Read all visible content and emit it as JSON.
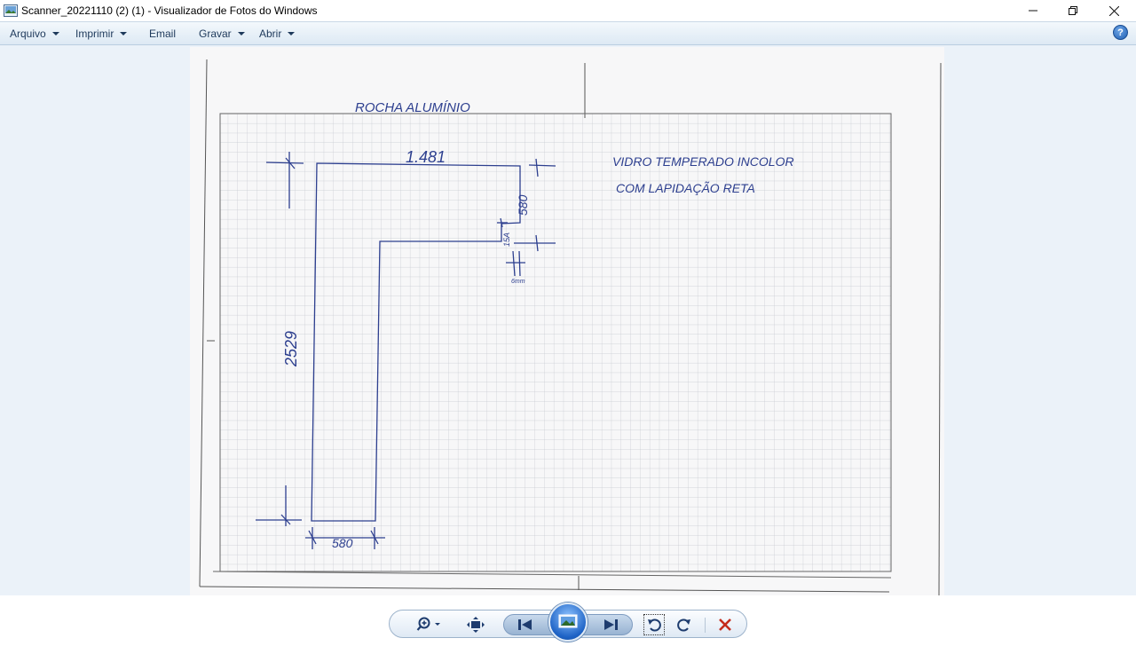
{
  "window": {
    "title": "Scanner_20221110 (2) (1) - Visualizador de Fotos do Windows",
    "minimize_glyph": "—",
    "maximize_glyph": "❐",
    "close_glyph": "✕"
  },
  "menu": {
    "items": [
      {
        "label": "Arquivo",
        "has_dropdown": true
      },
      {
        "label": "Imprimir",
        "has_dropdown": true
      },
      {
        "label": "Email",
        "has_dropdown": false
      },
      {
        "label": "Gravar",
        "has_dropdown": true
      },
      {
        "label": "Abrir",
        "has_dropdown": true
      }
    ],
    "help_glyph": "?"
  },
  "photo": {
    "heading": "ROCHA ALUMÍNIO",
    "note_line1": "VIDRO TEMPERADO INCOLOR",
    "note_line2": "COM LAPIDAÇÃO RETA",
    "dim_top": "1.481",
    "dim_right": "580",
    "dim_step": "15A",
    "dim_gap": "6mm",
    "dim_left": "2529",
    "dim_bottom": "580"
  },
  "toolbar": {
    "icons": [
      "zoom-icon",
      "fit-window-icon",
      "previous-icon",
      "slideshow-icon",
      "next-icon",
      "rotate-left-icon",
      "rotate-right-icon",
      "delete-icon"
    ],
    "colors": {
      "accent": "#1d62c5",
      "delete": "#c42b1c",
      "ink": "#2d3f8f"
    }
  }
}
